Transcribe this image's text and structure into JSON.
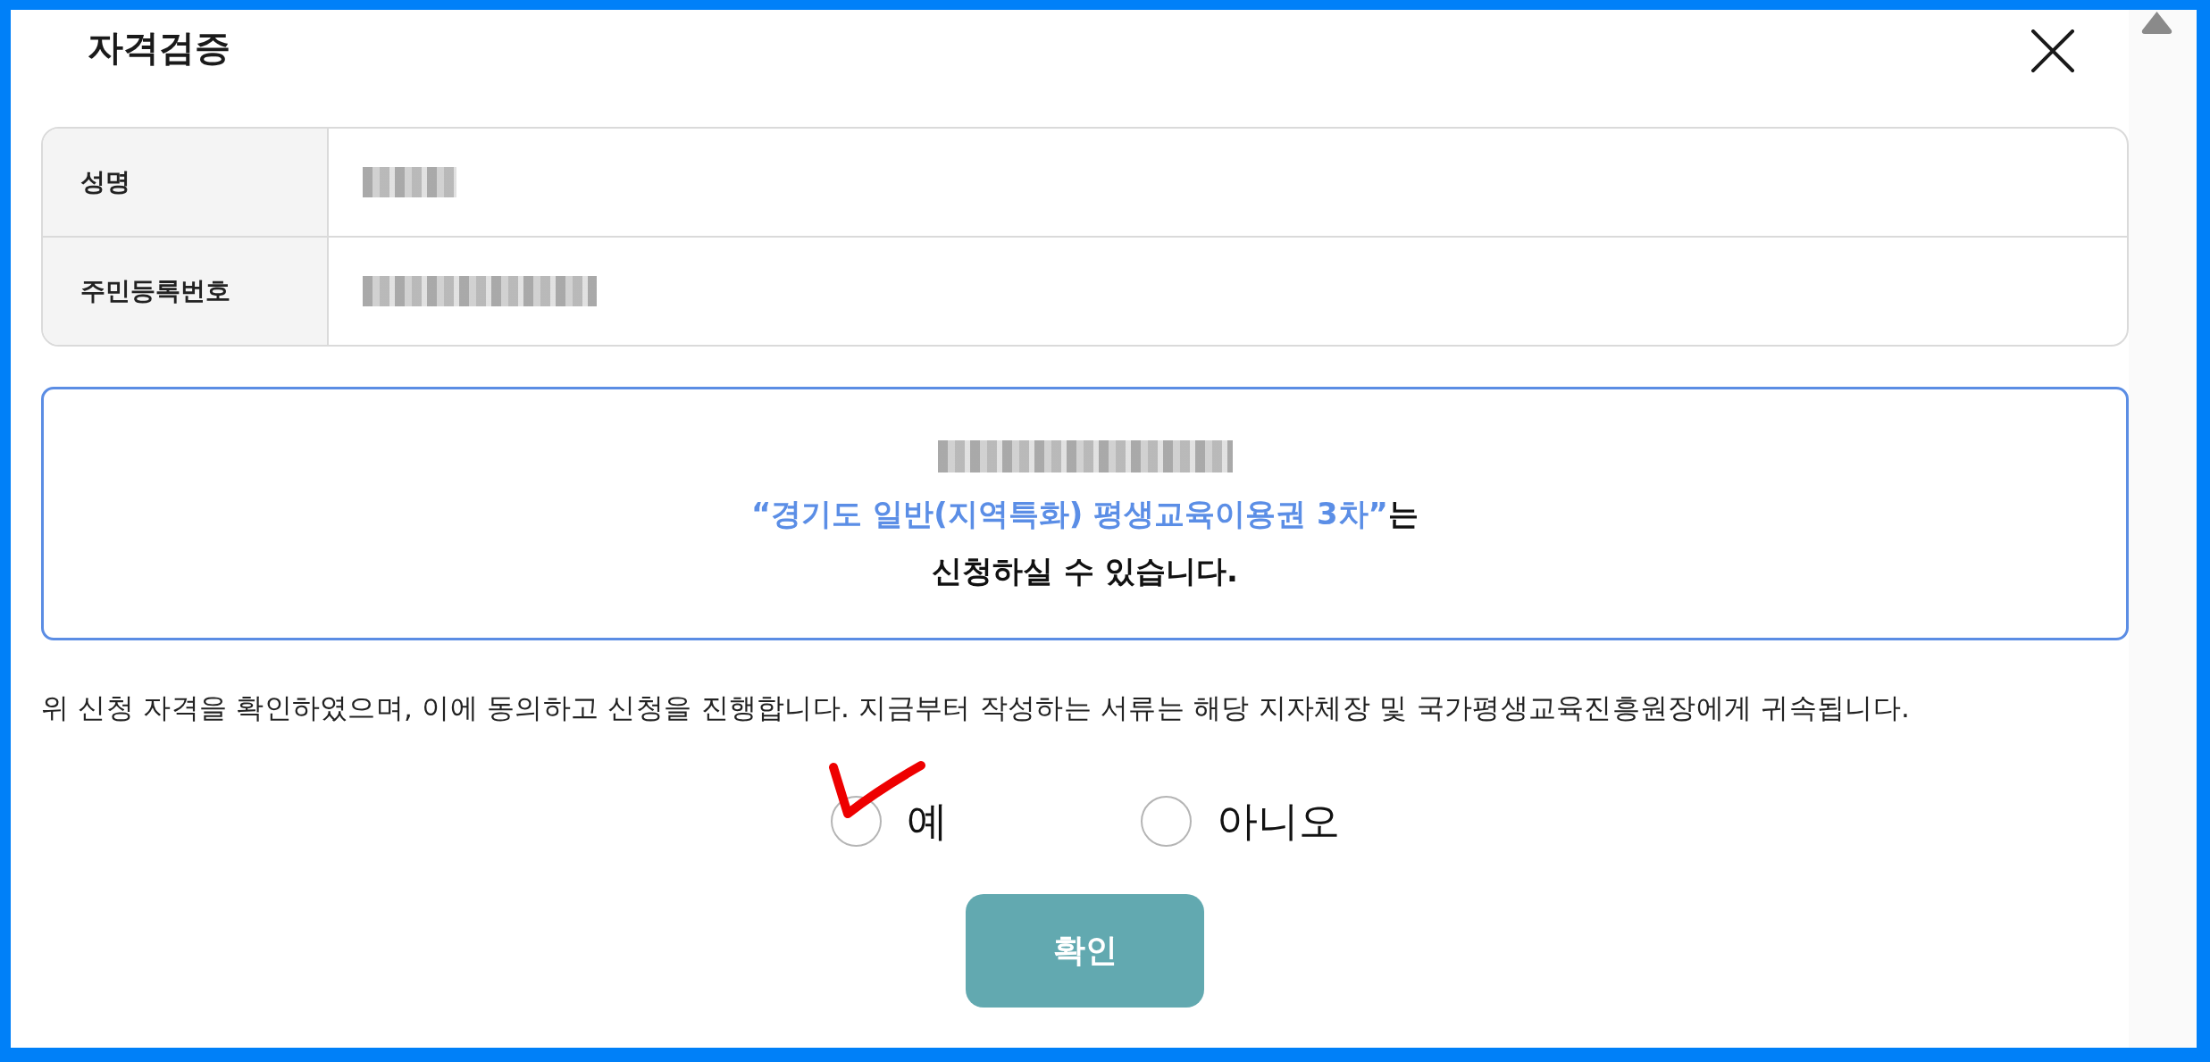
{
  "dialog": {
    "title": "자격검증"
  },
  "info_table": {
    "rows": [
      {
        "label": "성명",
        "redacted": true
      },
      {
        "label": "주민등록번호",
        "redacted": true
      }
    ]
  },
  "notice": {
    "redacted_line": true,
    "highlight": "“경기도 일반(지역특화) 평생교육이용권 3차”",
    "highlight_suffix": "는",
    "message": "신청하실 수 있습니다."
  },
  "agreement": {
    "text": "위 신청 자격을 확인하였으며, 이에 동의하고 신청을 진행합니다. 지금부터 작성하는 서류는 해당 지자체장 및 국가평생교육진흥원장에게 귀속됩니다.",
    "options": [
      {
        "label": "예",
        "selected": false,
        "annotated": true
      },
      {
        "label": "아니오",
        "selected": false,
        "annotated": false
      }
    ]
  },
  "confirm_button": {
    "label": "확인"
  }
}
